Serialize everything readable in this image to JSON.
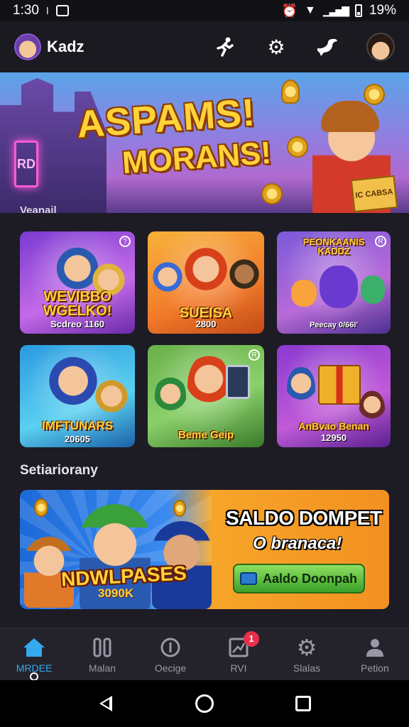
{
  "status_bar": {
    "time": "1:30",
    "battery": "19%"
  },
  "header": {
    "username": "Kadz"
  },
  "hero": {
    "title_line1": "ASPAMS!",
    "title_line2": "MORANS!",
    "sign_left": "RD",
    "sign_right": "IC CABSA",
    "faint_label": "Veanail"
  },
  "games": [
    {
      "title": "WEVIBBO WGELKO!",
      "subtitle": "Scdreo 1160",
      "badge": "?"
    },
    {
      "title": "SUEISA",
      "subtitle": "2800",
      "badge": ""
    },
    {
      "title": "PEONKAANIS KADDZ",
      "subtitle": "Peecay 0/66I'",
      "badge": "R"
    },
    {
      "title": "IMFTUNARS",
      "subtitle": "20605",
      "badge": ""
    },
    {
      "title": "Beme Geip",
      "subtitle": "",
      "badge": "R"
    },
    {
      "title": "AnBvao Benan",
      "subtitle": "12950",
      "badge": ""
    }
  ],
  "section": {
    "title": "Setiariorany"
  },
  "promo": {
    "heading": "SALDO DOMPET",
    "subheading": "O branaca!",
    "big_text": "NDWLPASES",
    "amount": "3090K",
    "button_label": "Aaldo Doonpah"
  },
  "bottom_nav": [
    {
      "label": "MRDEE",
      "icon": "home-icon",
      "active": true
    },
    {
      "label": "Malan",
      "icon": "pause-icon",
      "active": false
    },
    {
      "label": "Oecige",
      "icon": "info-icon",
      "active": false
    },
    {
      "label": "RVI",
      "icon": "image-icon",
      "active": false,
      "badge": "1"
    },
    {
      "label": "Slalas",
      "icon": "gear-icon",
      "active": false
    },
    {
      "label": "Petion",
      "icon": "person-icon",
      "active": false
    }
  ],
  "colors": {
    "accent": "#35a8f0",
    "badge": "#e8304a",
    "gold": "#ffd23a"
  }
}
